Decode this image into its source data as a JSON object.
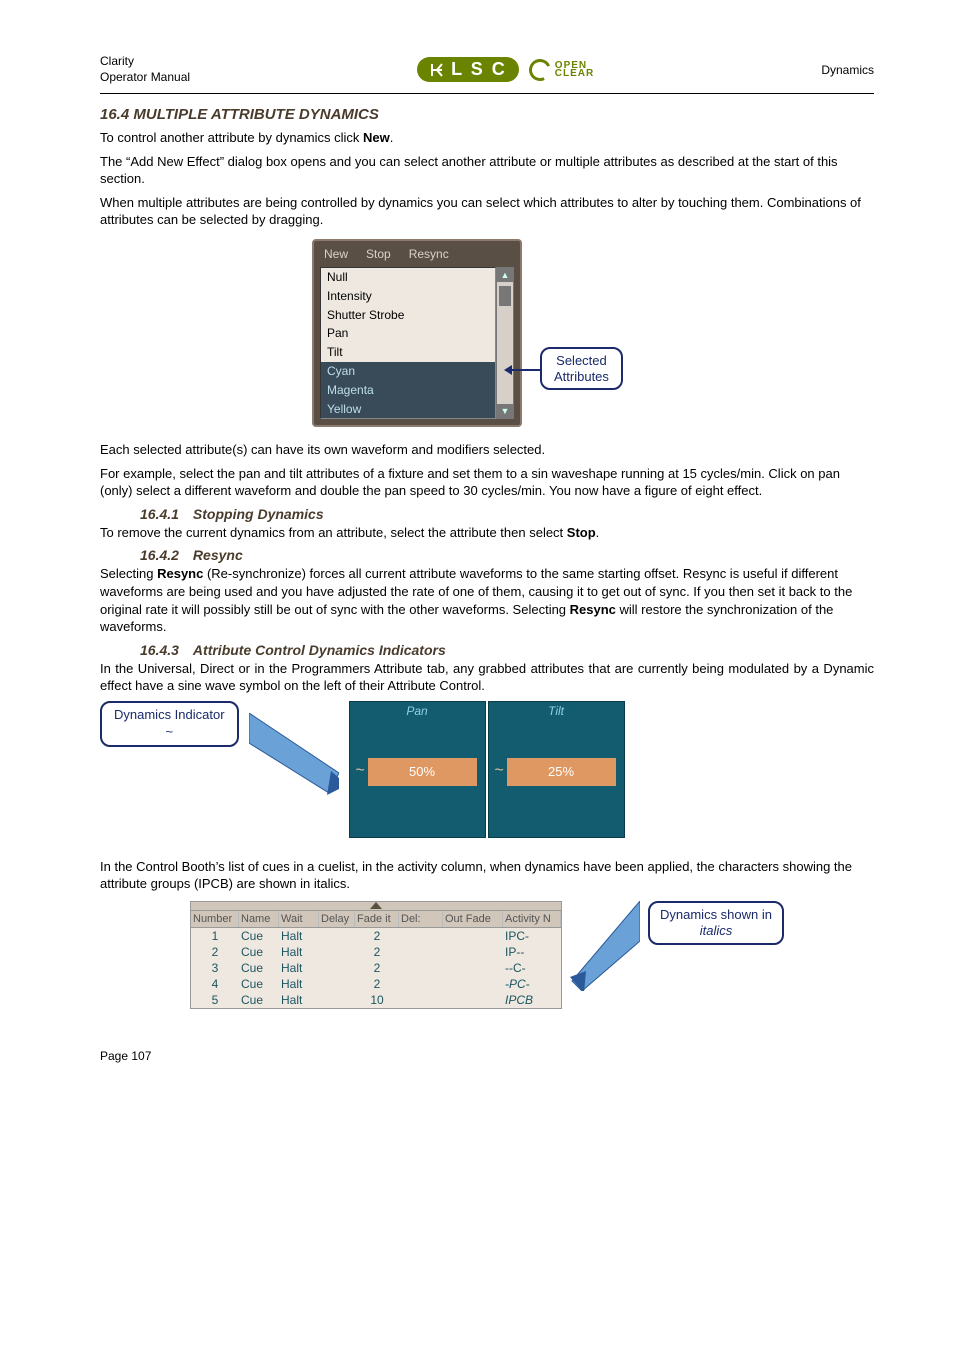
{
  "header": {
    "left_line1": "Clarity",
    "left_line2": "Operator Manual",
    "right": "Dynamics",
    "logo_lsc": "L S C",
    "logo_oc_top": "OPEN",
    "logo_oc_bottom": "CLEAR"
  },
  "sec_16_4": {
    "title": "16.4 MULTIPLE ATTRIBUTE DYNAMICS",
    "p1_a": "To control another attribute by dynamics click ",
    "p1_b": "New",
    "p1_c": ".",
    "p2": "The “Add New Effect” dialog box opens and you can select another attribute or multiple attributes as described at the start of this section.",
    "p3": "When multiple attributes are being controlled by dynamics you can select which attributes to alter by touching them. Combinations of attributes can be selected by dragging.",
    "p4": "Each selected attribute(s) can have its own waveform and modifiers selected.",
    "p5": "For example, select the pan and tilt attributes of a fixture and set them to a sin waveshape running at 15 cycles/min. Click on pan (only) select a different waveform and double the pan speed to 30 cycles/min. You now have a figure of eight effect."
  },
  "fig1": {
    "tabs": {
      "new": "New",
      "stop": "Stop",
      "resync": "Resync"
    },
    "items": {
      "0": "Null",
      "1": "Intensity",
      "2": "Shutter Strobe",
      "3": "Pan",
      "4": "Tilt",
      "5": "Cyan",
      "6": "Magenta",
      "7": "Yellow"
    },
    "callout_line1": "Selected",
    "callout_line2": "Attributes"
  },
  "sec_16_4_1": {
    "title": "16.4.1 Stopping Dynamics",
    "p_a": "To remove the current dynamics from an attribute, select the attribute then select ",
    "p_b": "Stop",
    "p_c": "."
  },
  "sec_16_4_2": {
    "title": "16.4.2 Resync",
    "p_a": "Selecting ",
    "p_b": "Resync",
    "p_c": " (Re-synchronize) forces all current attribute waveforms to the same starting offset. Resync is useful if different waveforms are being used and you have adjusted the rate of one of them, causing it to get out of sync. If you then set it back to the original rate it will possibly still be out of sync with the other waveforms. Selecting ",
    "p_d": "Resync",
    "p_e": " will restore the synchronization of the waveforms."
  },
  "sec_16_4_3": {
    "title": "16.4.3 Attribute Control Dynamics Indicators",
    "p1": "In the Universal, Direct or in the Programmers Attribute tab, any grabbed attributes that are currently being modulated by a Dynamic effect have a sine wave symbol on the left of their Attribute Control.",
    "p2": "In the Control Booth’s list of cues in a cuelist, in the activity column, when dynamics have been applied, the characters showing the attribute groups (IPCB) are shown in italics."
  },
  "fig2": {
    "callout_line1": "Dynamics Indicator",
    "callout_line2": "~",
    "pan_label": "Pan",
    "tilt_label": "Tilt",
    "pan_value": "50%",
    "tilt_value": "25%",
    "tilde": "~"
  },
  "fig3": {
    "cols": {
      "c0": "Number",
      "c1": "Name",
      "c2": "Wait",
      "c3": "Delay",
      "c4": "Fade it",
      "c5": "Del:",
      "c6": "Out Fade",
      "c7": "Activity N"
    },
    "rows": {
      "0": {
        "num": "1",
        "name": "Cue",
        "wait": "Halt",
        "fade": "2",
        "act": "IPC-",
        "ital": false
      },
      "1": {
        "num": "2",
        "name": "Cue",
        "wait": "Halt",
        "fade": "2",
        "act": "IP--",
        "ital": false
      },
      "2": {
        "num": "3",
        "name": "Cue",
        "wait": "Halt",
        "fade": "2",
        "act": "--C-",
        "ital": false
      },
      "3": {
        "num": "4",
        "name": "Cue",
        "wait": "Halt",
        "fade": "2",
        "act": "-PC-",
        "ital": true
      },
      "4": {
        "num": "5",
        "name": "Cue",
        "wait": "Halt",
        "fade": "10",
        "act": "IPCB",
        "ital": true
      }
    },
    "callout_line1": "Dynamics shown in",
    "callout_line2": "italics"
  },
  "footer": "Page 107"
}
